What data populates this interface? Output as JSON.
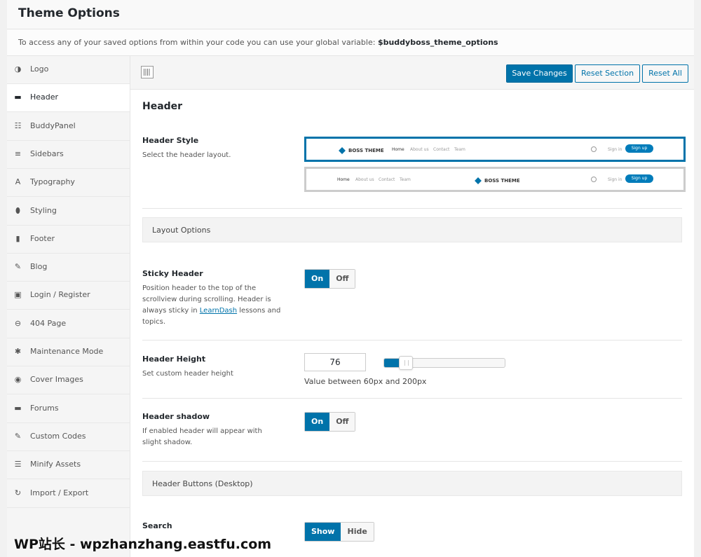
{
  "page": {
    "title": "Theme Options"
  },
  "info": {
    "prefix": "To access any of your saved options from within your code you can use your global variable:",
    "variable": "$buddyboss_theme_options"
  },
  "sidebar": {
    "items": [
      {
        "label": "Logo",
        "icon": "half-circle-icon",
        "glyph": "◑"
      },
      {
        "label": "Header",
        "icon": "header-card-icon",
        "glyph": "▬"
      },
      {
        "label": "BuddyPanel",
        "icon": "list-icon",
        "glyph": "☷"
      },
      {
        "label": "Sidebars",
        "icon": "menu-lines-icon",
        "glyph": "≡"
      },
      {
        "label": "Typography",
        "icon": "font-icon",
        "glyph": "A"
      },
      {
        "label": "Styling",
        "icon": "drop-icon",
        "glyph": "⬮"
      },
      {
        "label": "Footer",
        "icon": "bookmark-icon",
        "glyph": "▮"
      },
      {
        "label": "Blog",
        "icon": "edit-icon",
        "glyph": "✎"
      },
      {
        "label": "Login / Register",
        "icon": "lock-icon",
        "glyph": "▣"
      },
      {
        "label": "404 Page",
        "icon": "minus-circle-icon",
        "glyph": "⊖"
      },
      {
        "label": "Maintenance Mode",
        "icon": "gear-icon",
        "glyph": "✱"
      },
      {
        "label": "Cover Images",
        "icon": "camera-icon",
        "glyph": "◉"
      },
      {
        "label": "Forums",
        "icon": "chat-icon",
        "glyph": "▬"
      },
      {
        "label": "Custom Codes",
        "icon": "edit-icon",
        "glyph": "✎"
      },
      {
        "label": "Minify Assets",
        "icon": "list-icon",
        "glyph": "☰"
      },
      {
        "label": "Import / Export",
        "icon": "refresh-icon",
        "glyph": "↻"
      }
    ],
    "active_index": 1
  },
  "toolbar": {
    "save_label": "Save Changes",
    "reset_section_label": "Reset Section",
    "reset_all_label": "Reset All"
  },
  "section": {
    "title": "Header"
  },
  "header_style": {
    "label": "Header Style",
    "desc": "Select the header layout.",
    "preview": {
      "logo": "BOSS THEME",
      "nav": [
        "Home",
        "About us",
        "Contact",
        "Team"
      ],
      "signin": "Sign in",
      "signup": "Sign up"
    }
  },
  "layout_options": {
    "label": "Layout Options"
  },
  "sticky_header": {
    "label": "Sticky Header",
    "desc_before": "Position header to the top of the scrollview during scrolling. Header is always sticky in",
    "desc_link": "LearnDash",
    "desc_after": "lessons and topics.",
    "on": "On",
    "off": "Off"
  },
  "header_height": {
    "label": "Header Height",
    "desc": "Set custom header height",
    "value": "76",
    "range_text": "Value between 60px and 200px",
    "min": 60,
    "max": 200
  },
  "header_shadow": {
    "label": "Header shadow",
    "desc": "If enabled header will appear with slight shadow.",
    "on": "On",
    "off": "Off"
  },
  "header_buttons": {
    "label": "Header Buttons (Desktop)"
  },
  "search": {
    "label": "Search",
    "show": "Show",
    "hide": "Hide"
  },
  "watermark": "WP站长 - wpzhanzhang.eastfu.com",
  "colors": {
    "primary": "#0073aa"
  }
}
